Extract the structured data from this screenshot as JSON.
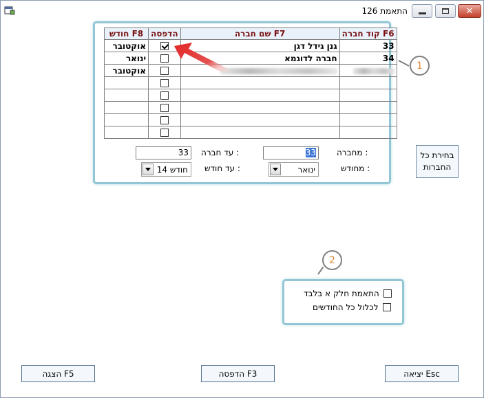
{
  "window": {
    "title": "התאמת 126",
    "icons": {
      "app": "app-icon",
      "minimize": "minimize-icon",
      "maximize": "maximize-icon",
      "close": "close-icon"
    }
  },
  "grid": {
    "headers": {
      "month": "חודש F8",
      "print": "הדפסה",
      "name": "שם חברה F7",
      "code": "קוד חברה F6"
    },
    "rows": [
      {
        "month": "אוקטובר",
        "print_checked": true,
        "name": "גנן גידל דגן",
        "code": "33"
      },
      {
        "month": "ינואר",
        "print_checked": false,
        "name": "חברה לדוגמא",
        "code": "34"
      },
      {
        "month": "אוקטובר",
        "print_checked": false,
        "name": "",
        "code": ""
      },
      {
        "month": "",
        "print_checked": false,
        "name": "",
        "code": ""
      },
      {
        "month": "",
        "print_checked": false,
        "name": "",
        "code": ""
      },
      {
        "month": "",
        "print_checked": false,
        "name": "",
        "code": ""
      },
      {
        "month": "",
        "print_checked": false,
        "name": "",
        "code": ""
      },
      {
        "month": "",
        "print_checked": false,
        "name": "",
        "code": ""
      }
    ]
  },
  "filters": {
    "from_company_label": "מחברה :",
    "from_company_value": "33",
    "to_company_label": "עד חברה :",
    "to_company_value": "33",
    "from_month_label": "מחודש :",
    "from_month_value": "ינואר",
    "to_month_label": "עד חודש :",
    "to_month_value": "חודש 14"
  },
  "select_all_button": {
    "line1": "בחירת כל",
    "line2": "החברות"
  },
  "options": {
    "partial_only": {
      "label": "התאמת חלק א בלבד",
      "checked": false
    },
    "include_all_months": {
      "label": "לכלול כל החודשים",
      "checked": false
    }
  },
  "buttons": {
    "exit": "יציאה Esc",
    "print": "הדפסה F3",
    "display": "הצגה F5"
  },
  "callouts": {
    "one": "1",
    "two": "2"
  },
  "colors": {
    "panel_border": "#93c6d4",
    "header_text": "#7a1313",
    "callout_number": "#e08a3c",
    "arrow": "#e32626"
  }
}
